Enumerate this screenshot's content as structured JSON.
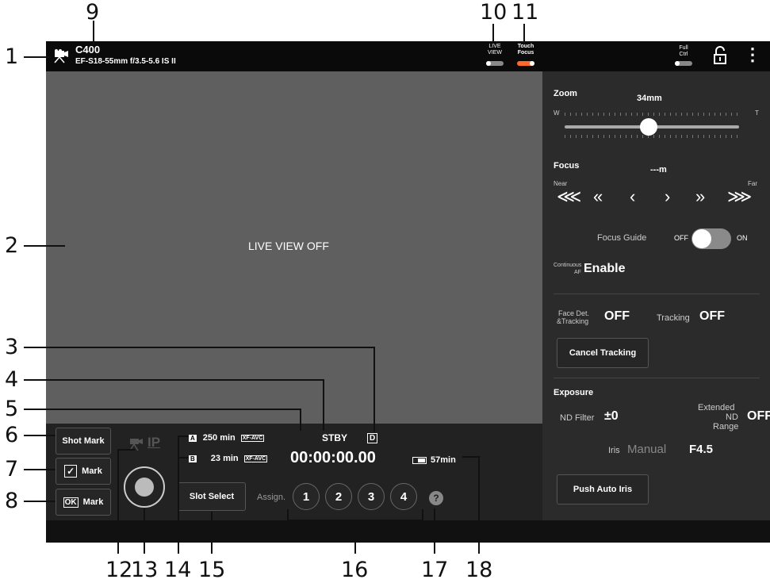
{
  "callouts": [
    "1",
    "2",
    "3",
    "4",
    "5",
    "6",
    "7",
    "8",
    "9",
    "10",
    "11",
    "12",
    "13",
    "14",
    "15",
    "16",
    "17",
    "18"
  ],
  "topbar": {
    "camera_name": "C400",
    "lens_name": "EF-S18-55mm f/3.5-5.6 IS II",
    "live_view_label_1": "LIVE",
    "live_view_label_2": "VIEW",
    "touch_focus_label_1": "Touch",
    "touch_focus_label_2": "Focus",
    "full_ctrl_label_1": "Full",
    "full_ctrl_label_2": "Ctrl",
    "menu_glyph": "⋮"
  },
  "preview": {
    "status_text": "LIVE VIEW OFF"
  },
  "recording": {
    "mode": "STBY",
    "timecode": "00:00:00.00",
    "d_icon": "D",
    "slot_a_letter": "A",
    "slot_a_time": "250 min",
    "slot_a_format": "XF-AVC",
    "slot_b_letter": "B",
    "slot_b_time": "23 min",
    "slot_b_format": "XF-AVC",
    "battery_time": "57min",
    "ip_label": "IP"
  },
  "buttons": {
    "shot_mark": "Shot Mark",
    "check_mark": "Mark",
    "check_glyph": "✓",
    "ok_mark": "Mark",
    "ok_glyph": "OK",
    "slot_select": "Slot Select",
    "assign_label": "Assign.",
    "assign_1": "1",
    "assign_2": "2",
    "assign_3": "3",
    "assign_4": "4",
    "help": "?"
  },
  "panel": {
    "zoom_label": "Zoom",
    "zoom_value": "34mm",
    "zoom_w": "W",
    "zoom_t": "T",
    "zoom_level": 0.48,
    "focus_label": "Focus",
    "focus_value": "---m",
    "focus_near": "Near",
    "focus_far": "Far",
    "focus_buttons": [
      "⋘",
      "«",
      "‹",
      "›",
      "»",
      "⋙"
    ],
    "focus_guide_label": "Focus Guide",
    "focus_guide_off": "OFF",
    "focus_guide_on": "ON",
    "continuous_af_label_1": "Continuous",
    "continuous_af_label_2": "AF",
    "continuous_af_value": "Enable",
    "face_det_label_1": "Face Det.",
    "face_det_label_2": "&Tracking",
    "face_det_value": "OFF",
    "tracking_label": "Tracking",
    "tracking_value": "OFF",
    "cancel_tracking": "Cancel Tracking",
    "exposure_label": "Exposure",
    "nd_filter_label": "ND Filter",
    "nd_filter_value": "±0",
    "extended_nd_label_1": "Extended",
    "extended_nd_label_2": "ND",
    "extended_nd_label_3": "Range",
    "extended_nd_value": "OFF",
    "iris_label": "Iris",
    "iris_mode": "Manual",
    "iris_value": "F4.5",
    "push_auto_iris": "Push Auto Iris"
  },
  "colors": {
    "accent_orange": "#ff6a2b",
    "preview_gray": "#5f5f5f",
    "panel_bg": "#2b2b2b"
  }
}
